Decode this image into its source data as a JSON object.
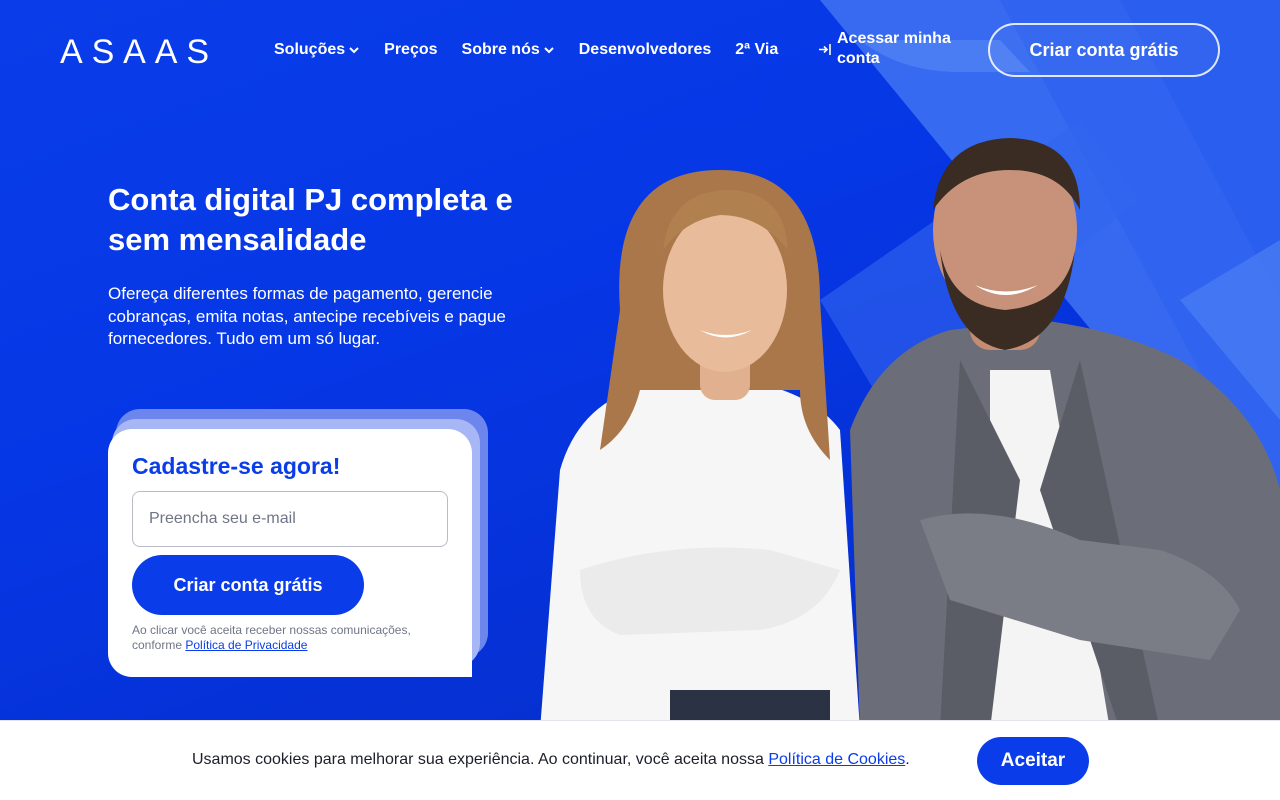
{
  "brand": {
    "logo_text": "ASAAS",
    "primary": "#0a3de9",
    "white": "#ffffff"
  },
  "nav": {
    "items": [
      {
        "label": "Soluções",
        "icon": "chevron-down-icon"
      },
      {
        "label": "Preços"
      },
      {
        "label": "Sobre nós",
        "icon": "chevron-down-icon"
      },
      {
        "label": "Desenvolvedores"
      },
      {
        "label": "2ª Via"
      }
    ],
    "login_label": "Acessar minha conta",
    "login_icon": "login-arrow-icon",
    "cta_label": "Criar conta grátis"
  },
  "hero": {
    "headline": "Conta digital PJ completa e sem mensalidade",
    "subtext": "Ofereça diferentes formas de pagamento, gerencie cobranças, emita notas, antecipe recebíveis e pague fornecedores. Tudo em um só lugar."
  },
  "signup": {
    "title": "Cadastre-se agora!",
    "email_placeholder": "Preencha seu e-mail",
    "email_value": "",
    "button_label": "Criar conta grátis",
    "consent_text": "Ao clicar você aceita receber nossas comunicações, conforme ",
    "privacy_link": "Política de Privacidade"
  },
  "cookie": {
    "text": "Usamos cookies para melhorar sua experiência. Ao continuar, você aceita nossa ",
    "link": "Política de Cookies",
    "suffix": ".",
    "accept_label": "Aceitar"
  }
}
